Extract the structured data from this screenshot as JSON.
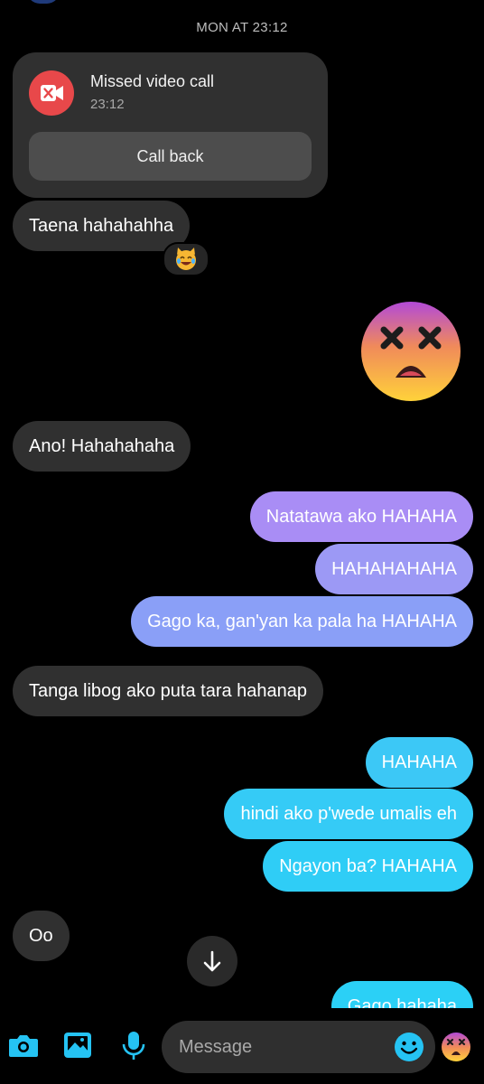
{
  "thread": {
    "date_separator": "MON AT 23:12"
  },
  "missed_call": {
    "title": "Missed video call",
    "time": "23:12",
    "action_label": "Call back",
    "icon": "video-camera-x-icon",
    "accent": "#e8484a"
  },
  "messages": {
    "m1": "Taena hahahahha",
    "m1_reaction": "crying-laughing-cat",
    "m2_sticker": "dizzy-face-emoji",
    "m3": "Ano! Hahahahaha",
    "m4": "Natatawa ako HAHAHA",
    "m5": "HAHAHAHAHA",
    "m6": "Gago ka, gan'yan ka pala ha HAHAHA",
    "m7": "Tanga libog ako puta tara hahanap",
    "m8": "HAHAHA",
    "m9": "hindi ako p'wede umalis eh",
    "m10": "Ngayon ba? HAHAHA",
    "m11": "Oo",
    "m12": "Gago hahaha"
  },
  "composer": {
    "placeholder": "Message",
    "icons": [
      "camera-icon",
      "gallery-icon",
      "microphone-icon",
      "emoji-icon",
      "quick-reaction-dizzy-icon"
    ]
  },
  "colors": {
    "incoming_bubble": "#303030",
    "outgoing_gradient_top": "#a98df5",
    "outgoing_gradient_bottom": "#2bd0f6",
    "icon_accent": "#25c3f3"
  }
}
